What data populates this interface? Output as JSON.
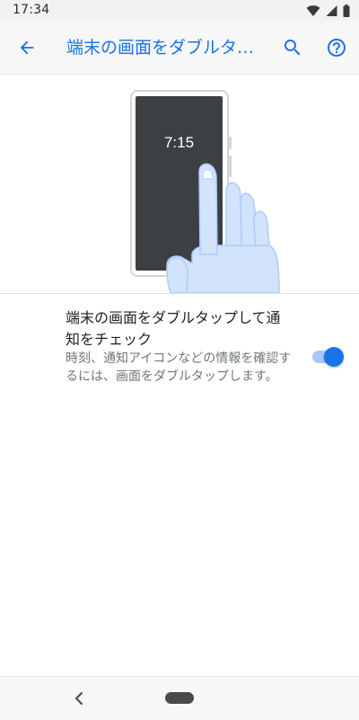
{
  "status_bar": {
    "time": "17:34",
    "icons": [
      "wifi-icon",
      "cellular-signal-icon",
      "battery-icon"
    ]
  },
  "app_bar": {
    "title": "端末の画面をダブルタップして通知をチェック",
    "back_icon": "arrow-back-icon",
    "search_icon": "search-icon",
    "help_icon": "help-circle-icon",
    "accent_color": "#1a73e8"
  },
  "illustration": {
    "clock_text": "7:15"
  },
  "setting": {
    "title": "端末の画面をダブルタップして通知をチェック",
    "summary": "時刻、通知アイコンなどの情報を確認するには、画面をダブルタップします。",
    "toggle_on": true
  },
  "nav_bar": {
    "back_icon": "nav-back-icon",
    "home_icon": "home-pill-icon"
  }
}
